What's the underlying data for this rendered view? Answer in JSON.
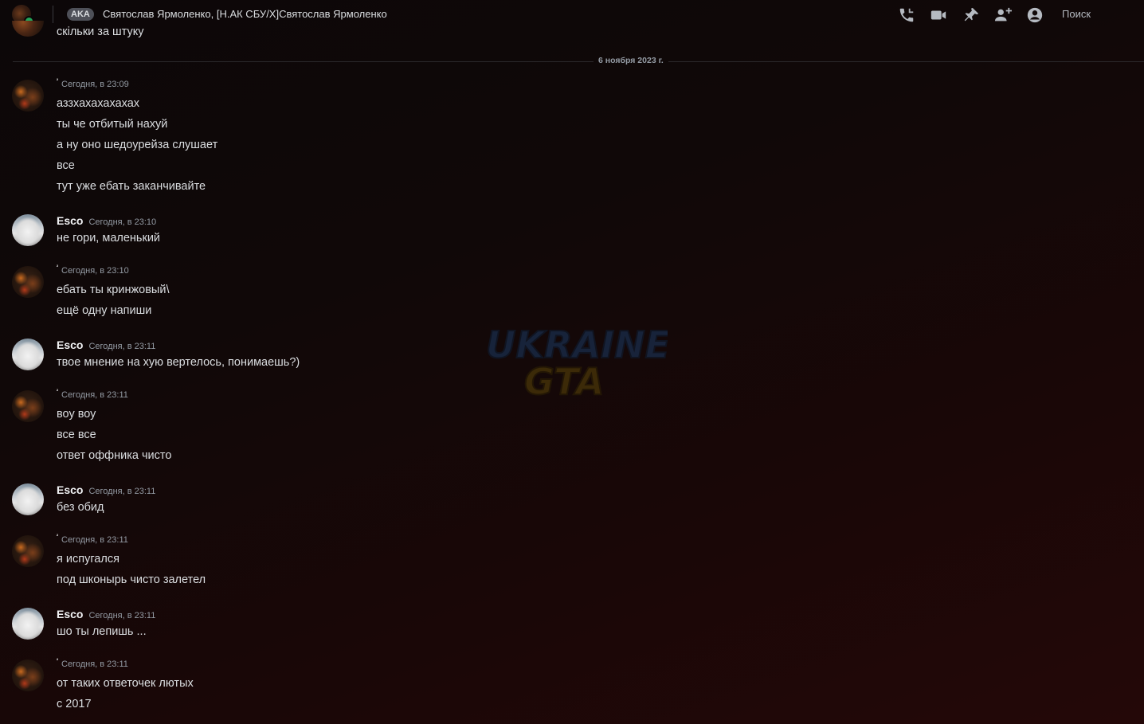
{
  "header": {
    "tag": "AKA",
    "title": "Святослав Ярмоленко, [Н.АК СБУ/Х]Святослав Ярмоленко",
    "search": "Поиск",
    "icons": [
      "phone-call-icon",
      "video-camera-icon",
      "pin-icon",
      "add-friend-icon",
      "profile-icon"
    ]
  },
  "cut_message": {
    "text": "скільки за штуку"
  },
  "date_divider": "6 ноября 2023 г.",
  "watermark": {
    "line1": "UKRAINE",
    "line2": "GTA",
    "color1": "#1b3a63",
    "color2": "#5c4608"
  },
  "messages": [
    {
      "author": "²",
      "time": "Сегодня, в 23:09",
      "lines": [
        "аззхахахахахах",
        "ты че отбитый нахуй",
        "а ну оно шедоурейза слушает",
        "все",
        "тут уже ебать заканчивайте"
      ]
    },
    {
      "author": "Esco",
      "time": "Сегодня, в 23:10",
      "lines": [
        "не гори, маленький"
      ]
    },
    {
      "author": "²",
      "time": "Сегодня, в 23:10",
      "lines": [
        "ебать ты кринжовый\\",
        "ещё одну напиши"
      ]
    },
    {
      "author": "Esco",
      "time": "Сегодня, в 23:11",
      "lines": [
        "твое мнение на хую вертелось, понимаешь?)"
      ]
    },
    {
      "author": "²",
      "time": "Сегодня, в 23:11",
      "lines": [
        "воу воу",
        "все все",
        "ответ оффника чисто"
      ]
    },
    {
      "author": "Esco",
      "time": "Сегодня, в 23:11",
      "lines": [
        "без обид"
      ]
    },
    {
      "author": "²",
      "time": "Сегодня, в 23:11",
      "lines": [
        "я испугался",
        "под шконырь чисто залетел"
      ]
    },
    {
      "author": "Esco",
      "time": "Сегодня, в 23:11",
      "lines": [
        "шо ты лепишь ..."
      ]
    },
    {
      "author": "²",
      "time": "Сегодня, в 23:11",
      "lines": [
        "от таких ответочек лютых",
        "с 2017"
      ]
    }
  ]
}
